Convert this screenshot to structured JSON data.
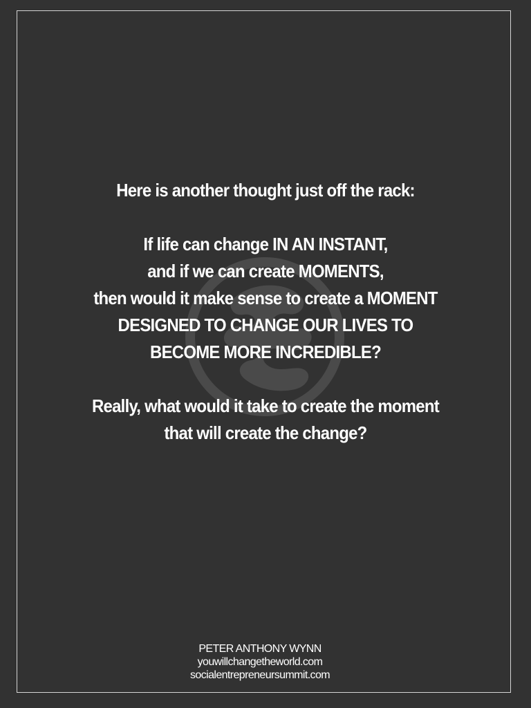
{
  "quote": {
    "intro": "Here is another thought just off the rack:",
    "paragraph1": [
      "If life can change IN AN INSTANT,",
      "and if we can create MOMENTS,",
      "then would it make sense to create a MOMENT",
      "DESIGNED TO CHANGE OUR LIVES TO",
      "BECOME MORE INCREDIBLE?"
    ],
    "paragraph2": [
      "Really, what would it take to create the moment",
      "that will create the change?"
    ]
  },
  "credits": {
    "author": "PETER ANTHONY WYNN",
    "website1": "youwillchangetheworld.com",
    "website2": "socialentrepreneursummit.com"
  },
  "colors": {
    "background": "#323232",
    "text": "#ffffff",
    "border": "#d6d6d6",
    "watermark": "#4a4a4a"
  },
  "icons": {
    "watermark": "dragon-emblem-icon"
  }
}
